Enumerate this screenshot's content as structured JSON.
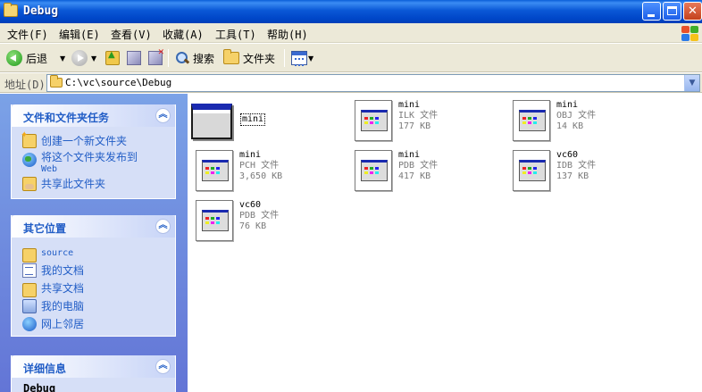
{
  "window": {
    "title": "Debug",
    "minimize_label": "_",
    "maximize_label": "□",
    "close_label": "✕"
  },
  "menu": {
    "items": [
      {
        "label": "文件(F)"
      },
      {
        "label": "编辑(E)"
      },
      {
        "label": "查看(V)"
      },
      {
        "label": "收藏(A)"
      },
      {
        "label": "工具(T)"
      },
      {
        "label": "帮助(H)"
      }
    ]
  },
  "toolbar": {
    "back_label": "后退",
    "search_label": "搜索",
    "folders_label": "文件夹",
    "dropdown_glyph": "▼"
  },
  "address": {
    "label": "地址(D)",
    "path": "C:\\vc\\source\\Debug",
    "dropdown_glyph": "▼"
  },
  "tasks_panel": {
    "title": "文件和文件夹任务",
    "chevron": "︽",
    "items": [
      {
        "label": "创建一个新文件夹"
      },
      {
        "label": "将这个文件夹发布到",
        "sub": "Web"
      },
      {
        "label": "共享此文件夹"
      }
    ]
  },
  "places_panel": {
    "title": "其它位置",
    "chevron": "︽",
    "items": [
      {
        "label": "source"
      },
      {
        "label": "我的文档"
      },
      {
        "label": "共享文档"
      },
      {
        "label": "我的电脑"
      },
      {
        "label": "网上邻居"
      }
    ]
  },
  "details_panel": {
    "title": "详细信息",
    "chevron": "︽",
    "text": "Debug"
  },
  "files": [
    {
      "name": "mini",
      "type": "",
      "size": "",
      "icon": "application-icon",
      "selected": true
    },
    {
      "name": "mini",
      "type": "ILK 文件",
      "size": "177 KB",
      "icon": "document-icon"
    },
    {
      "name": "mini",
      "type": "OBJ 文件",
      "size": "14 KB",
      "icon": "document-icon"
    },
    {
      "name": "mini",
      "type": "PCH 文件",
      "size": "3,650 KB",
      "icon": "document-icon"
    },
    {
      "name": "mini",
      "type": "PDB 文件",
      "size": "417 KB",
      "icon": "document-icon"
    },
    {
      "name": "vc60",
      "type": "IDB 文件",
      "size": "137 KB",
      "icon": "document-icon"
    },
    {
      "name": "vc60",
      "type": "PDB 文件",
      "size": "76 KB",
      "icon": "document-icon"
    }
  ]
}
